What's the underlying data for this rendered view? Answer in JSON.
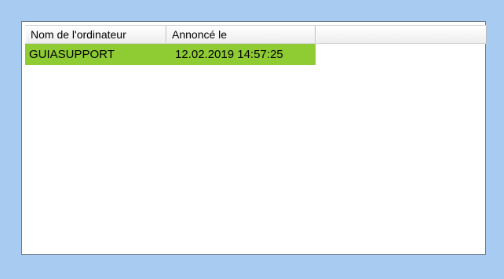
{
  "list": {
    "columns": [
      {
        "label": "Nom de l'ordinateur"
      },
      {
        "label": "Annoncé le"
      },
      {
        "label": ""
      }
    ],
    "rows": [
      {
        "computer_name": "GUIASUPPORT",
        "announced_at": "12.02.2019 14:57:25",
        "highlight_color": "#8fcc34"
      }
    ]
  },
  "colors": {
    "window_background": "#a8cbf1",
    "panel_background": "#ffffff",
    "panel_border": "#6f7680",
    "selected_row": "#8fcc34"
  }
}
